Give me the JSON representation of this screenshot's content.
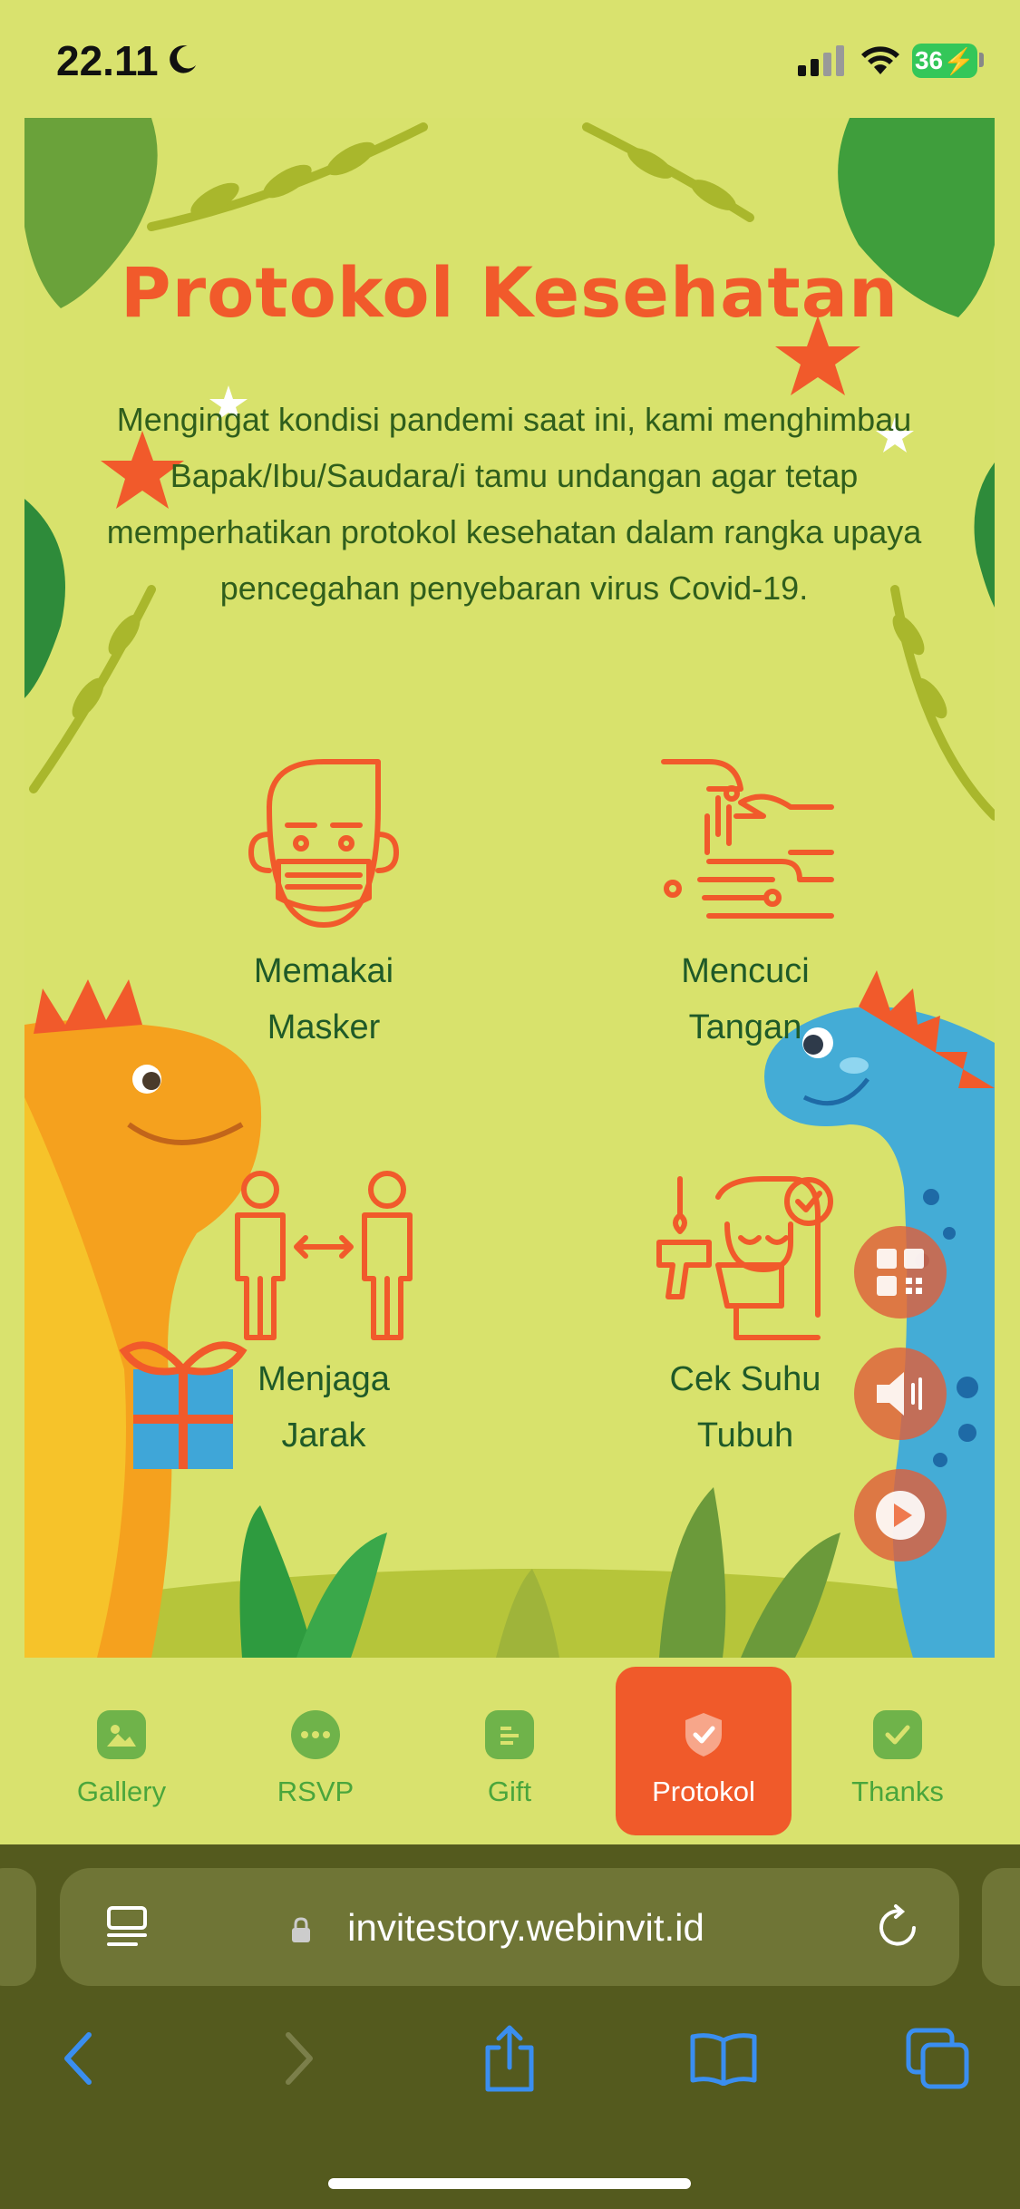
{
  "status_bar": {
    "time": "22.11",
    "battery": "36"
  },
  "card": {
    "title": "Protokol Kesehatan",
    "intro": "Mengingat kondisi pandemi saat ini, kami menghimbau Bapak/Ibu/Saudara/i tamu undangan agar tetap memperhatikan protokol kesehatan dalam rangka upaya pencegahan penyebaran virus Covid-19.",
    "protocols": [
      {
        "line1": "Memakai",
        "line2": "Masker",
        "icon": "mask-icon"
      },
      {
        "line1": "Mencuci",
        "line2": "Tangan",
        "icon": "handwash-icon"
      },
      {
        "line1": "Menjaga",
        "line2": "Jarak",
        "icon": "distance-icon"
      },
      {
        "line1": "Cek Suhu",
        "line2": "Tubuh",
        "icon": "thermometer-icon"
      }
    ]
  },
  "floating_buttons": [
    {
      "icon": "qr-code-icon"
    },
    {
      "icon": "speaker-icon"
    },
    {
      "icon": "play-icon"
    }
  ],
  "bottom_nav": {
    "items": [
      {
        "label": "Gallery",
        "icon": "image-icon"
      },
      {
        "label": "RSVP",
        "icon": "chat-icon"
      },
      {
        "label": "Gift",
        "icon": "document-icon"
      },
      {
        "label": "Protokol",
        "icon": "shield-check-icon",
        "active": true
      },
      {
        "label": "Thanks",
        "icon": "check-icon"
      }
    ]
  },
  "browser": {
    "url": "invitestory.webinvit.id"
  },
  "colors": {
    "background": "#d9e26e",
    "title": "#f15a2b",
    "text_green": "#2f5e1c",
    "active_tab": "#f05a2a",
    "browser_bar": "#545a1e"
  }
}
